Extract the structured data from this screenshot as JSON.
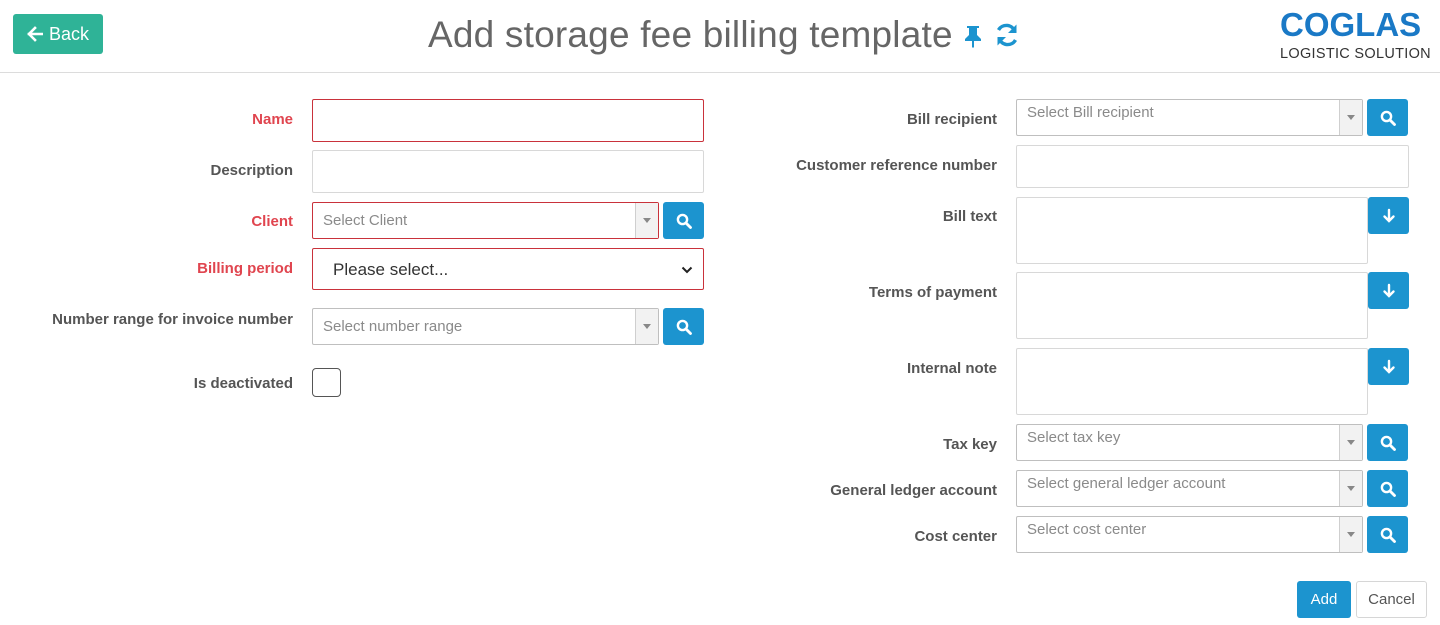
{
  "header": {
    "back_label": "Back",
    "title": "Add storage fee billing template",
    "logo_main": "COGLAS",
    "logo_sub": "LOGISTIC SOLUTION"
  },
  "left_form": {
    "name_label": "Name",
    "description_label": "Description",
    "client_label": "Client",
    "client_placeholder": "Select Client",
    "billing_period_label": "Billing period",
    "billing_period_value": "Please select...",
    "number_range_label": "Number range for invoice number",
    "number_range_placeholder": "Select number range",
    "is_deactivated_label": "Is deactivated"
  },
  "right_form": {
    "bill_recipient_label": "Bill recipient",
    "bill_recipient_placeholder": "Select Bill recipient",
    "customer_ref_label": "Customer reference number",
    "bill_text_label": "Bill text",
    "terms_label": "Terms of payment",
    "internal_note_label": "Internal note",
    "tax_key_label": "Tax key",
    "tax_key_placeholder": "Select tax key",
    "gl_account_label": "General ledger account",
    "gl_account_placeholder": "Select general ledger account",
    "cost_center_label": "Cost center",
    "cost_center_placeholder": "Select cost center"
  },
  "footer": {
    "add_label": "Add",
    "cancel_label": "Cancel"
  },
  "colors": {
    "primary": "#1c94cf",
    "back_button": "#2fb397",
    "required": "#e0454f",
    "logo": "#1a79c6"
  },
  "icons": [
    "arrow-left-icon",
    "pin-icon",
    "refresh-icon",
    "search-icon",
    "arrow-down-icon",
    "chevron-down-icon"
  ]
}
